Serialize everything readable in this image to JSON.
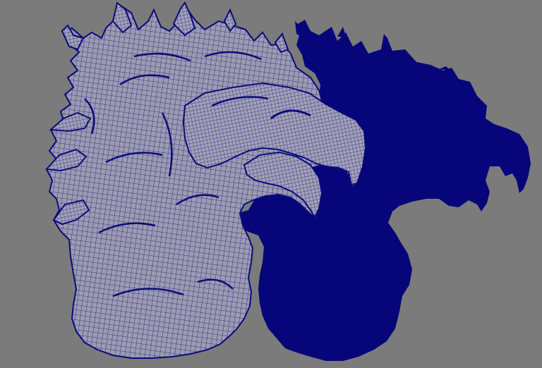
{
  "viewport": {
    "background_color": "#7b7b7b",
    "mesh_surface_color": "#9a99ad",
    "wireframe_color": "#0b0b7a",
    "silhouette_color": "#06067a"
  },
  "scene": {
    "objects": [
      {
        "name": "dragon-head-wireframe",
        "display": "wireframe-on-shaded"
      },
      {
        "name": "dragon-head-silhouette",
        "display": "flat"
      }
    ]
  }
}
